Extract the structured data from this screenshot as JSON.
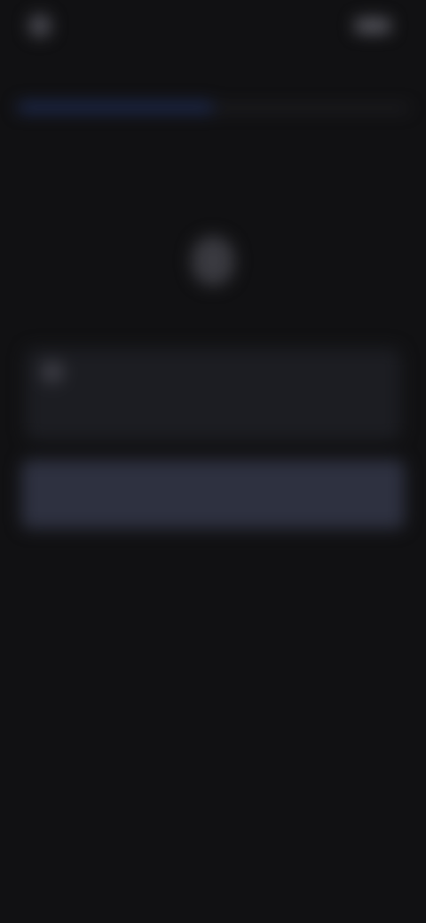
{
  "status_bar": {
    "left_text": "",
    "right_text": ""
  },
  "tabs": [
    {
      "label": "",
      "active": true
    },
    {
      "label": "",
      "active": false
    }
  ],
  "title": "",
  "card": {
    "line1": "",
    "line2": ""
  },
  "action_button": {
    "label": ""
  },
  "colors": {
    "background": "#111113",
    "active_tab": "#21305e",
    "button": "#2e3140"
  }
}
